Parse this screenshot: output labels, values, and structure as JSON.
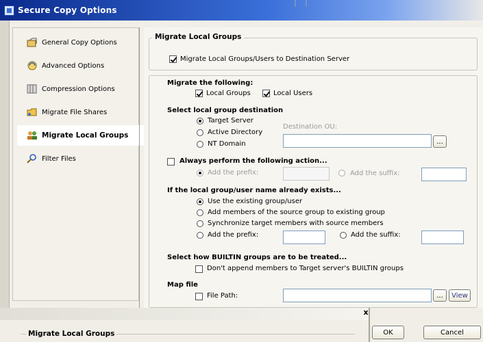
{
  "window": {
    "title": "Secure Copy Options"
  },
  "sidebar": {
    "items": [
      {
        "label": "General Copy Options",
        "icon": "general-copy-icon"
      },
      {
        "label": "Advanced Options",
        "icon": "advanced-options-icon"
      },
      {
        "label": "Compression Options",
        "icon": "compression-icon"
      },
      {
        "label": "Migrate File Shares",
        "icon": "file-shares-icon"
      },
      {
        "label": "Migrate Local Groups",
        "icon": "local-groups-icon",
        "selected": true
      },
      {
        "label": "Filter Files",
        "icon": "filter-files-icon"
      }
    ]
  },
  "main": {
    "group_title": "Migrate Local Groups",
    "migrate_checkbox": {
      "label": "Migrate Local Groups/Users to Destination Server",
      "checked": true
    },
    "migrate_following": {
      "title": "Migrate the following:",
      "local_groups": {
        "label": "Local Groups",
        "checked": true
      },
      "local_users": {
        "label": "Local Users",
        "checked": true
      }
    },
    "destination": {
      "title": "Select local group destination",
      "options": [
        "Target Server",
        "Active Directory",
        "NT Domain"
      ],
      "selected": "Target Server",
      "ou_label": "Destination OU:",
      "ou_value": "",
      "browse_label": "..."
    },
    "always_action": {
      "label": "Always perform the following action...",
      "checked": false,
      "prefix_label": "Add the prefix:",
      "suffix_label": "Add the suffix:",
      "prefix_value": "",
      "suffix_value": ""
    },
    "exists": {
      "title": "If the local group/user name already exists...",
      "options": [
        "Use the existing group/user",
        "Add members of the source group to existing group",
        "Synchronize target members with source members",
        "Add the prefix:"
      ],
      "selected": "Use the existing group/user",
      "suffix_label": "Add the suffix:",
      "prefix_value": "",
      "suffix_value": ""
    },
    "builtin": {
      "title": "Select how BUILTIN groups are to be treated...",
      "dont_append": {
        "label": "Don't append members to Target server's BUILTIN groups",
        "checked": false
      }
    },
    "map_file": {
      "title": "Map file",
      "file_path": {
        "label": "File Path:",
        "checked": false
      },
      "path_value": "",
      "browse_label": "...",
      "view_label": "View"
    }
  },
  "second_window": {
    "close_label": "x",
    "group_title": "Migrate Local Groups",
    "ok_label": "OK",
    "cancel_label": "Cancel"
  },
  "colors": {
    "title_bar": "#0a2a8c",
    "accent": "#3a6fd9",
    "selected_bg": "#ffffff"
  }
}
